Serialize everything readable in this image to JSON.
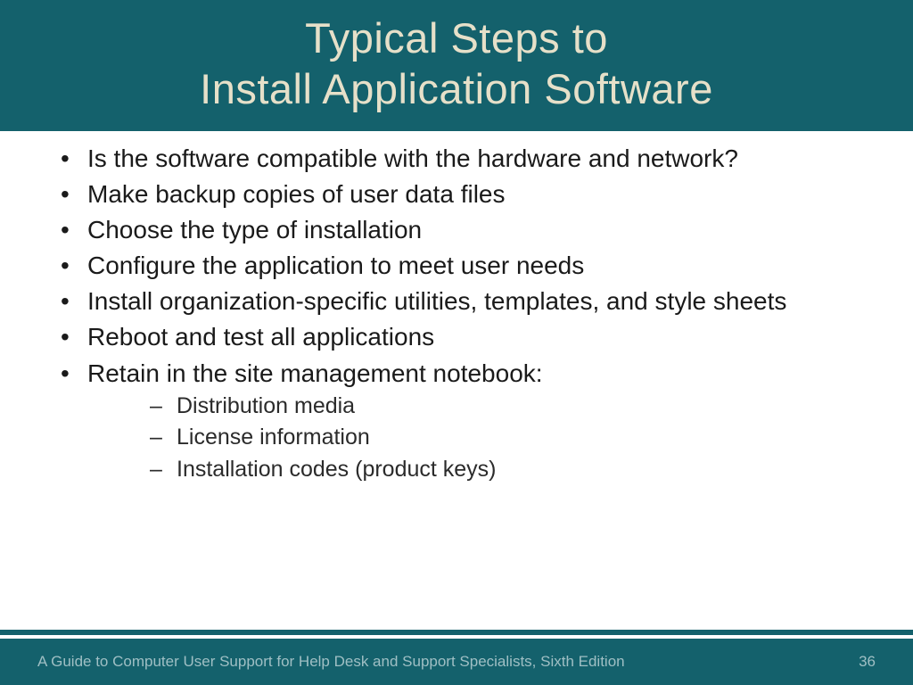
{
  "title_line1": "Typical Steps to",
  "title_line2": "Install Application Software",
  "bullets": [
    "Is the software compatible with the hardware and network?",
    "Make backup copies of user data files",
    "Choose the type of installation",
    "Configure the application to meet user needs",
    "Install organization-specific utilities, templates, and style sheets",
    "Reboot and test all applications",
    "Retain in the site management notebook:"
  ],
  "sub_bullets": [
    "Distribution media",
    "License information",
    "Installation codes (product keys)"
  ],
  "footer_text": "A Guide to Computer User Support for Help Desk and Support Specialists, Sixth Edition",
  "page_number": "36"
}
